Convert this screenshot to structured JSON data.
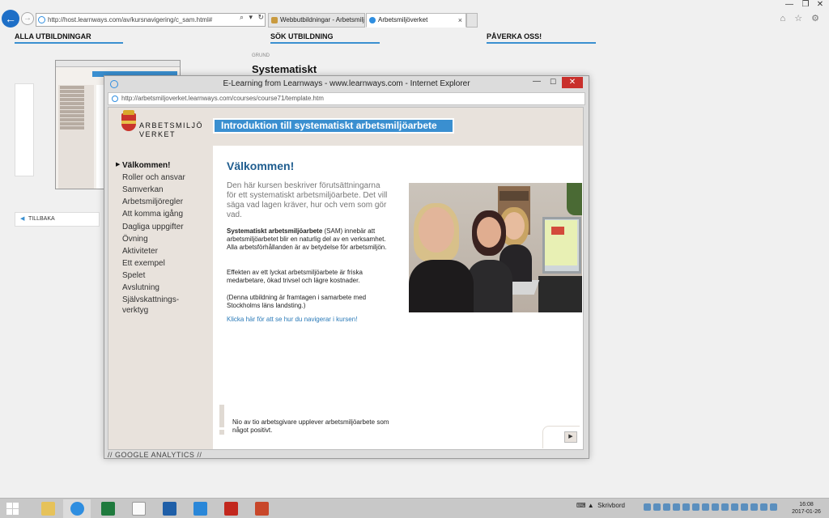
{
  "browser": {
    "url": "http://host.learnways.com/av/kursnavigering/c_sam.html#",
    "tabs": [
      {
        "label": "Webbutbildningar - Arbetsmilj..."
      },
      {
        "label": "Arbetsmiljöverket"
      }
    ],
    "back_label": "←",
    "forward_label": "→",
    "address_tools": "⌕ ▾ ↻",
    "tab_close": "×",
    "right_icons": "⌂ ☆ ⚙",
    "window_controls": {
      "minimize": "—",
      "restore": "❐",
      "close": "✕"
    }
  },
  "background_page": {
    "nav": [
      "ALLA UTBILDNINGAR",
      "SÖK UTBILDNING",
      "PÅVERKA OSS!"
    ],
    "breadcrumb": "GRUND",
    "title": "Systematiskt",
    "back_button": "TILLBAKA",
    "back_arrow": "◀"
  },
  "popup": {
    "title": "E-Learning from Learnways - www.learnways.com - Internet Explorer",
    "url": "http://arbetsmiljoverket.learnways.com/courses/course71/template.htm",
    "controls": {
      "minimize": "—",
      "maximize": "☐",
      "close": "✕"
    },
    "footer_text": "// GOOGLE ANALYTICS //"
  },
  "course": {
    "logo": {
      "line1": "ARBETSMILJÖ",
      "line2": "VERKET"
    },
    "banner": "Introduktion till systematiskt arbetsmiljöarbete",
    "menu": [
      {
        "label": "Välkommen!",
        "active": true
      },
      {
        "label": "Roller och ansvar"
      },
      {
        "label": "Samverkan"
      },
      {
        "label": "Arbetsmiljöregler"
      },
      {
        "label": "Att komma igång"
      },
      {
        "label": "Dagliga uppgifter"
      },
      {
        "label": "Övning"
      },
      {
        "label": "Aktiviteter"
      },
      {
        "label": "Ett exempel"
      },
      {
        "label": "Spelet"
      },
      {
        "label": "Avslutning"
      },
      {
        "label": "Självskattnings-"
      },
      {
        "label": "verktyg"
      }
    ],
    "active_marker": "▶",
    "heading": "Välkommen!",
    "intro": "Den här kursen beskriver förutsättningarna för ett systematiskt arbetsmiljöarbete. Det vill säga vad lagen kräver, hur och vem som gör vad.",
    "sam_bold": "Systematiskt arbetsmiljöarbete",
    "sam_rest": " (SAM) innebär att arbetsmiljöarbetet blir en naturlig del av en verk­samhet. Alla arbetsförhållanden är av betydelse för arbetsmiljön.",
    "effect": "Effekten av ett lyckat arbetsmiljöarbete är friska medarbetare, ökad trivsel och lägre kostnader.",
    "note": "(Denna utbildning är framtagen i samarbete med Stockholms läns landsting.)",
    "link": "Klicka här för att se hur du navigerar i kursen!",
    "fact": "Nio av tio arbetsgivare upplever arbetsmiljöarbete som något positivt.",
    "next_button": "▶"
  },
  "taskbar": {
    "desktop_label": "Skrivbord",
    "tray_symbols": "⌨ ▲",
    "time": "16:08",
    "date": "2017-01-26"
  }
}
